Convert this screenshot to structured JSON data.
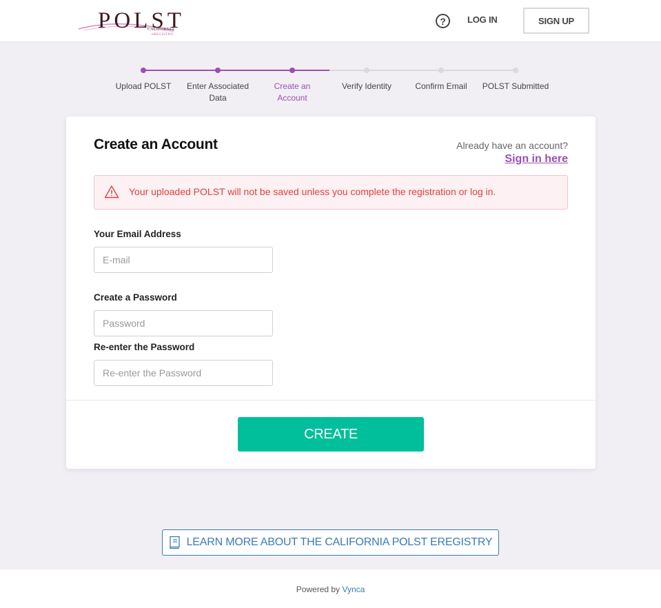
{
  "header": {
    "logo": {
      "main": "POLST",
      "sub1": "CALIFORNIA",
      "sub2": "eREGISTRY"
    },
    "help_icon": "question-circle-icon",
    "login_label": "LOG IN",
    "signup_label": "SIGN UP"
  },
  "stepper": {
    "steps": [
      {
        "label": "Upload POLST",
        "state": "complete"
      },
      {
        "label": "Enter Associated Data",
        "state": "complete"
      },
      {
        "label": "Create an Account",
        "state": "active"
      },
      {
        "label": "Verify Identity",
        "state": "pending"
      },
      {
        "label": "Confirm Email",
        "state": "pending"
      },
      {
        "label": "POLST Submitted",
        "state": "pending"
      }
    ],
    "colors": {
      "active": "#9b4fb3",
      "pending": "#d9d9d9"
    }
  },
  "card": {
    "title": "Create an Account",
    "already_text": "Already have an account?",
    "signin_label": "Sign in here",
    "alert": {
      "icon": "warning-triangle-icon",
      "text": "Your uploaded POLST will not be saved unless you complete the registration or log in."
    },
    "fields": {
      "email": {
        "label": "Your Email Address",
        "placeholder": "E-mail",
        "value": ""
      },
      "password": {
        "label": "Create a Password",
        "placeholder": "Password",
        "value": ""
      },
      "confirm": {
        "label": "Re-enter the Password",
        "placeholder": "Re-enter the Password",
        "value": ""
      }
    },
    "create_label": "CREATE"
  },
  "learn_more": {
    "icon": "book-icon",
    "label": "LEARN MORE ABOUT THE CALIFORNIA POLST EREGISTRY"
  },
  "footer": {
    "powered_by": "Powered by",
    "vynca": "Vynca"
  },
  "colors": {
    "brand_purple": "#9b4fb3",
    "create_green": "#00bf9a",
    "alert_red": "#e0403c",
    "link_blue": "#3a7ab8",
    "page_bg": "#f1eff4"
  }
}
